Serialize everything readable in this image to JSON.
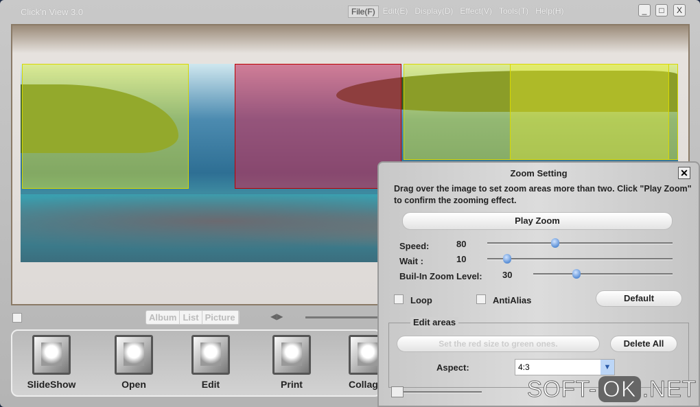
{
  "window": {
    "title": "Click'n View 3.0",
    "menu": [
      "File(F)",
      "Edit(E)",
      "Display(D)",
      "Effect(V)",
      "Tools(T)",
      "Help(H)"
    ],
    "controls": {
      "minimize": "_",
      "maximize": "□",
      "close": "X"
    }
  },
  "viewer": {
    "zoom_area_colors": {
      "selected": "#d22850",
      "area": "#ebf028"
    }
  },
  "view_tabs": [
    "Album",
    "List",
    "Picture"
  ],
  "nav_arrows": "◀▶",
  "toolbar": [
    {
      "label": "SlideShow",
      "icon": "slideshow-icon"
    },
    {
      "label": "Open",
      "icon": "open-icon"
    },
    {
      "label": "Edit",
      "icon": "edit-icon"
    },
    {
      "label": "Print",
      "icon": "print-icon"
    },
    {
      "label": "Collag",
      "icon": "collage-icon"
    }
  ],
  "dialog": {
    "title": "Zoom Setting",
    "close": "✕",
    "description": "Drag over the image to set zoom areas more than two. Click \"Play Zoom\" to confirm the zooming effect.",
    "play_zoom": "Play Zoom",
    "speed": {
      "label": "Speed:",
      "value": "80",
      "fraction": 0.36
    },
    "wait": {
      "label": "Wait  :",
      "value": "10",
      "fraction": 0.09
    },
    "zoom_level": {
      "label": "Buil-In Zoom Level:",
      "value": "30",
      "fraction": 0.3
    },
    "loop": {
      "label": "Loop",
      "checked": false
    },
    "antialias": {
      "label": "AntiAlias",
      "checked": false
    },
    "default": "Default",
    "edit_areas": {
      "legend": "Edit areas",
      "set_size": "Set the red size to green ones.",
      "delete_all": "Delete All",
      "aspect_label": "Aspect:",
      "aspect_value": "4:3"
    }
  },
  "watermark": {
    "pre": "SOFT-",
    "ok": "OK",
    "post": ".NET"
  }
}
